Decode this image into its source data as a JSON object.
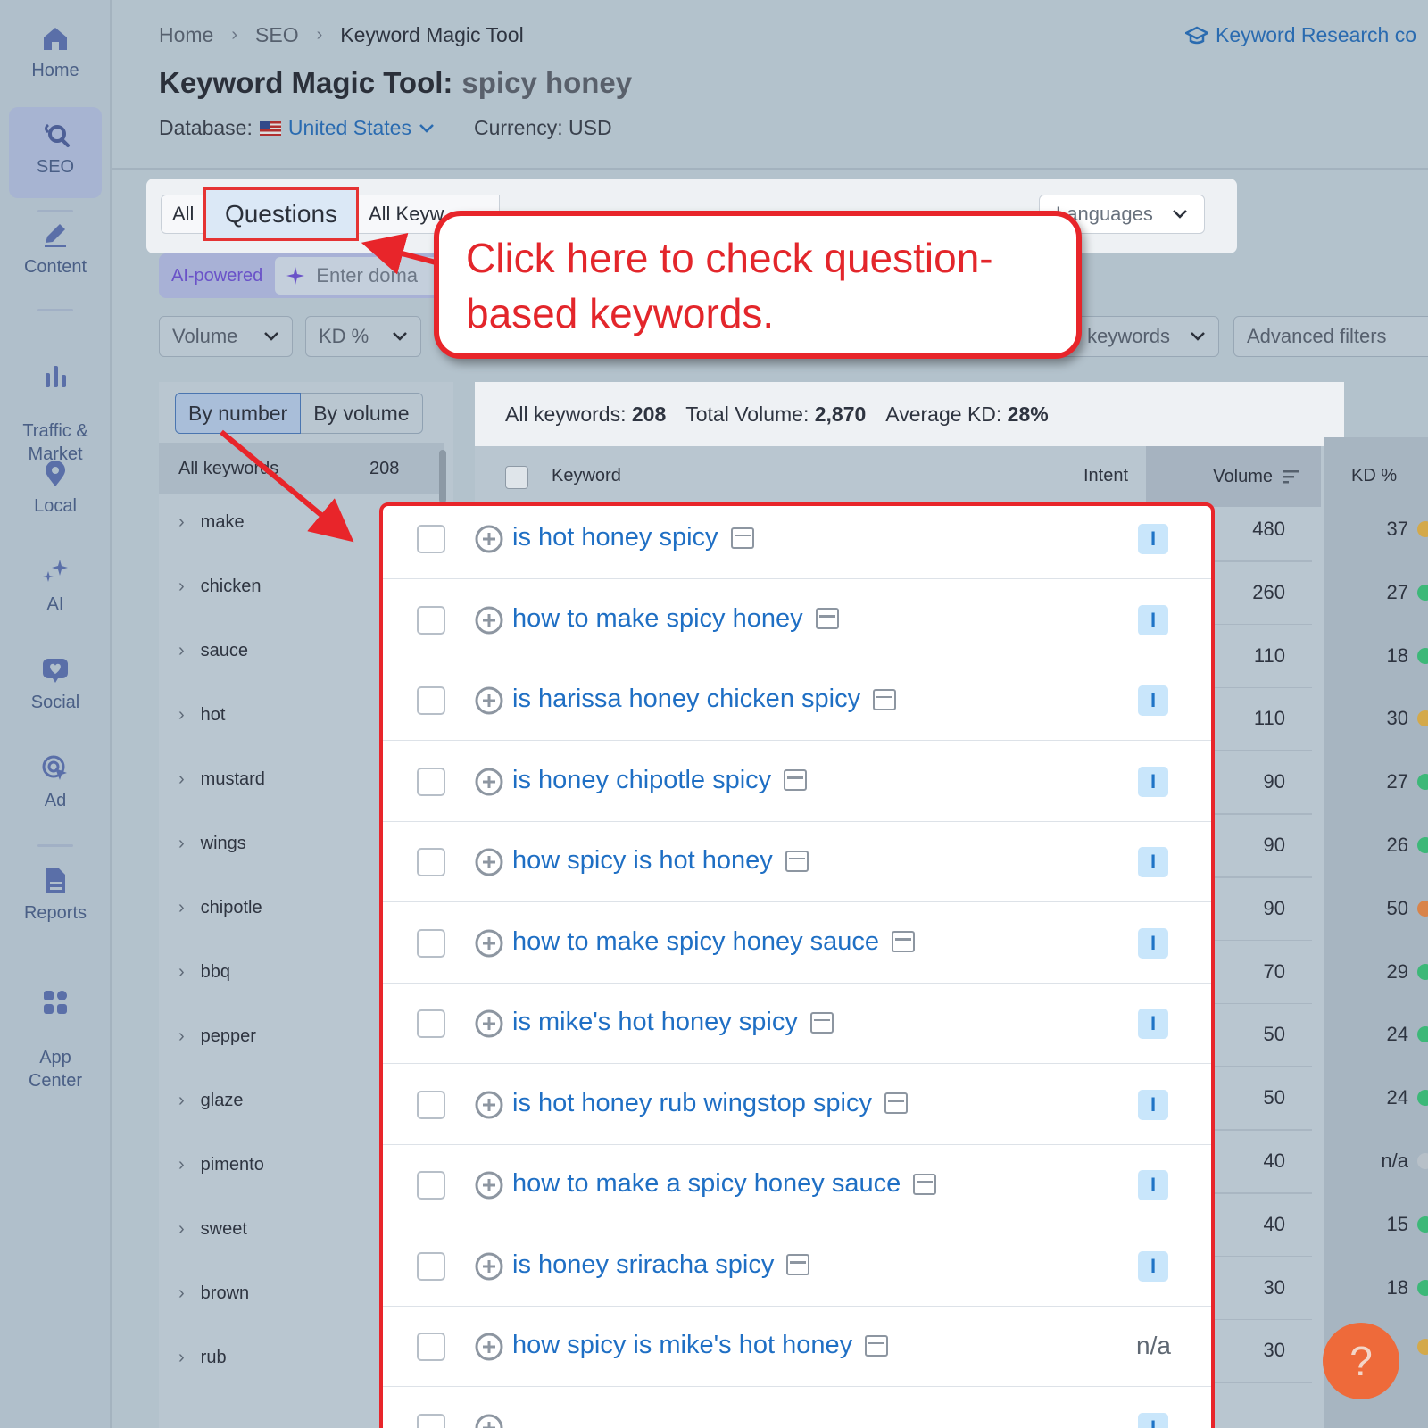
{
  "nav": {
    "items": [
      {
        "label": "Home",
        "icon": "home-icon"
      },
      {
        "label": "SEO",
        "icon": "seo-icon",
        "active": true
      },
      {
        "label": "Content",
        "icon": "pencil-icon"
      },
      {
        "label": "Traffic &\nMarket",
        "icon": "bar-chart-icon"
      },
      {
        "label": "Local",
        "icon": "map-pin-icon"
      },
      {
        "label": "AI",
        "icon": "sparkles-icon"
      },
      {
        "label": "Social",
        "icon": "heart-chat-icon"
      },
      {
        "label": "Ad",
        "icon": "target-cursor-icon"
      },
      {
        "label": "Reports",
        "icon": "document-icon"
      },
      {
        "label": "App\nCenter",
        "icon": "grid-icon"
      }
    ]
  },
  "breadcrumb": [
    "Home",
    "SEO",
    "Keyword Magic Tool"
  ],
  "course_link": "Keyword Research co",
  "title": {
    "tool": "Keyword Magic Tool:",
    "query": "spicy honey"
  },
  "database": {
    "label": "Database:",
    "country": "United States",
    "currency": "Currency: USD"
  },
  "tabs": {
    "all": "All",
    "questions": "Questions",
    "all_keywords": "All Keyw",
    "languages": "Languages"
  },
  "ai": {
    "badge": "AI-powered",
    "placeholder": "Enter doma"
  },
  "filters": {
    "volume": "Volume",
    "kd": "KD %",
    "keywords": "keywords",
    "advanced": "Advanced filters"
  },
  "groups": {
    "by_number": "By number",
    "by_volume": "By volume",
    "all_label": "All keywords",
    "all_count": "208",
    "items": [
      "make",
      "chicken",
      "sauce",
      "hot",
      "mustard",
      "wings",
      "chipotle",
      "bbq",
      "pepper",
      "glaze",
      "pimento",
      "sweet",
      "brown",
      "rub"
    ]
  },
  "summary": {
    "all_label": "All keywords:",
    "all_value": "208",
    "vol_label": "Total Volume:",
    "vol_value": "2,870",
    "kd_label": "Average KD:",
    "kd_value": "28%"
  },
  "table_head": {
    "keyword": "Keyword",
    "intent": "Intent",
    "volume": "Volume",
    "kd": "KD %"
  },
  "rows": [
    {
      "keyword": "is hot honey spicy",
      "intent": "I",
      "volume": "480",
      "kd": "37",
      "kd_color": "#d4a94a"
    },
    {
      "keyword": "how to make spicy honey",
      "intent": "I",
      "volume": "260",
      "kd": "27",
      "kd_color": "#3cb878"
    },
    {
      "keyword": "is harissa honey chicken spicy",
      "intent": "I",
      "volume": "110",
      "kd": "18",
      "kd_color": "#3cb878"
    },
    {
      "keyword": "is honey chipotle spicy",
      "intent": "I",
      "volume": "110",
      "kd": "30",
      "kd_color": "#d4a94a"
    },
    {
      "keyword": "how spicy is hot honey",
      "intent": "I",
      "volume": "90",
      "kd": "27",
      "kd_color": "#3cb878"
    },
    {
      "keyword": "how to make spicy honey sauce",
      "intent": "I",
      "volume": "90",
      "kd": "26",
      "kd_color": "#3cb878"
    },
    {
      "keyword": "is mike's hot honey spicy",
      "intent": "I",
      "volume": "90",
      "kd": "50",
      "kd_color": "#d9844a"
    },
    {
      "keyword": "is hot honey rub wingstop spicy",
      "intent": "I",
      "volume": "70",
      "kd": "29",
      "kd_color": "#3cb878"
    },
    {
      "keyword": "how to make a spicy honey sauce",
      "intent": "I",
      "volume": "50",
      "kd": "24",
      "kd_color": "#3cb878"
    },
    {
      "keyword": "is honey sriracha spicy",
      "intent": "I",
      "volume": "50",
      "kd": "24",
      "kd_color": "#3cb878"
    },
    {
      "keyword": "how spicy is mike's hot honey",
      "intent": "n/a",
      "volume": "40",
      "kd": "n/a",
      "kd_color": "#b7c0c8"
    },
    {
      "keyword": "",
      "intent": "I",
      "volume": "40",
      "kd": "15",
      "kd_color": "#3cb878"
    }
  ],
  "extra_rows": [
    {
      "volume": "30",
      "kd": "18",
      "kd_color": "#3cb878"
    },
    {
      "volume": "30",
      "kd": "",
      "kd_color": "#d4a94a"
    }
  ],
  "callout": "Click here to check question-based keywords.",
  "help": "?",
  "colors": {
    "accent": "#1f6fc4",
    "annotation": "#e8252a",
    "help": "#ee6a3a"
  }
}
